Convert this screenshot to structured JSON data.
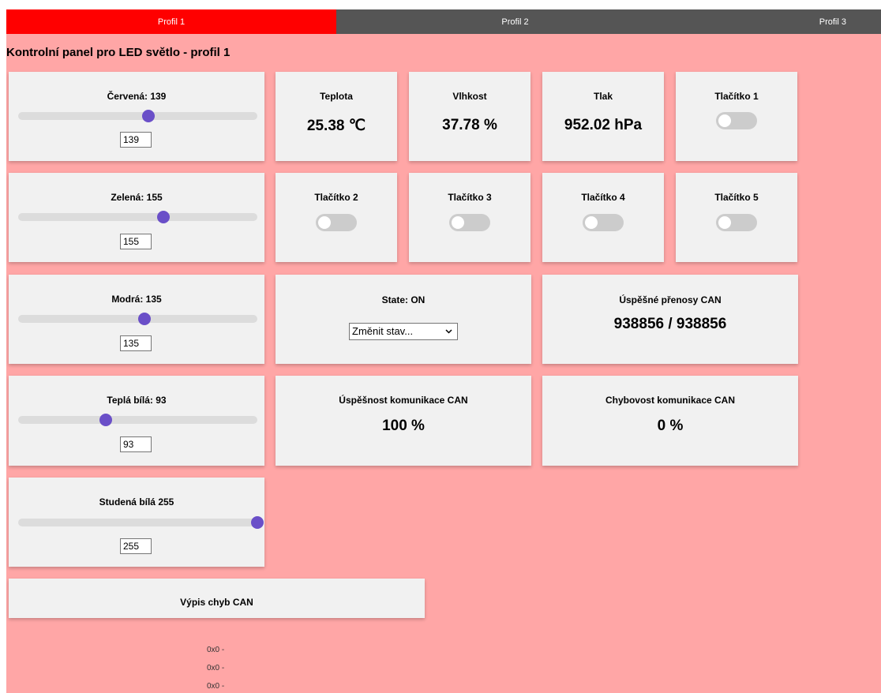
{
  "tabs": [
    "Profil 1",
    "Profil 2",
    "Profil 3"
  ],
  "page_title": "Kontrolní panel pro LED světlo - profil 1",
  "sliders": {
    "red": {
      "label": "Červená: 139",
      "value": "139",
      "fraction": 0.545
    },
    "green": {
      "label": "Zelená: 155",
      "value": "155",
      "fraction": 0.608
    },
    "blue": {
      "label": "Modrá: 135",
      "value": "135",
      "fraction": 0.529
    },
    "warm": {
      "label": "Teplá bílá: 93",
      "value": "93",
      "fraction": 0.365
    },
    "cold": {
      "label": "Studená bílá 255",
      "value": "255",
      "fraction": 1.0
    }
  },
  "sensors": {
    "temp": {
      "label": "Teplota",
      "value": "25.38 ℃"
    },
    "humid": {
      "label": "Vlhkost",
      "value": "37.78 %"
    },
    "press": {
      "label": "Tlak",
      "value": "952.02 hPa"
    }
  },
  "buttons": [
    "Tlačítko 1",
    "Tlačítko 2",
    "Tlačítko 3",
    "Tlačítko 4",
    "Tlačítko 5"
  ],
  "state": {
    "label": "State: ON",
    "select_text": "Změnit stav..."
  },
  "can": {
    "transfers_label": "Úspěšné přenosy CAN",
    "transfers_value": "938856 / 938856",
    "success_label": "Úspěšnost komunikace CAN",
    "success_value": "100 %",
    "error_label": "Chybovost komunikace CAN",
    "error_value": "0 %",
    "errors_button": "Výpis chyb CAN",
    "error_lines": [
      "0x0 -",
      "0x0 -",
      "0x0 -"
    ]
  },
  "colors": {
    "active_tab": "#ff0000",
    "tab_bar": "#555555",
    "background": "#ffa6a6",
    "slider_knob": "#6a4fc8"
  },
  "icons": {
    "dropdown": "chevron-down-icon"
  }
}
